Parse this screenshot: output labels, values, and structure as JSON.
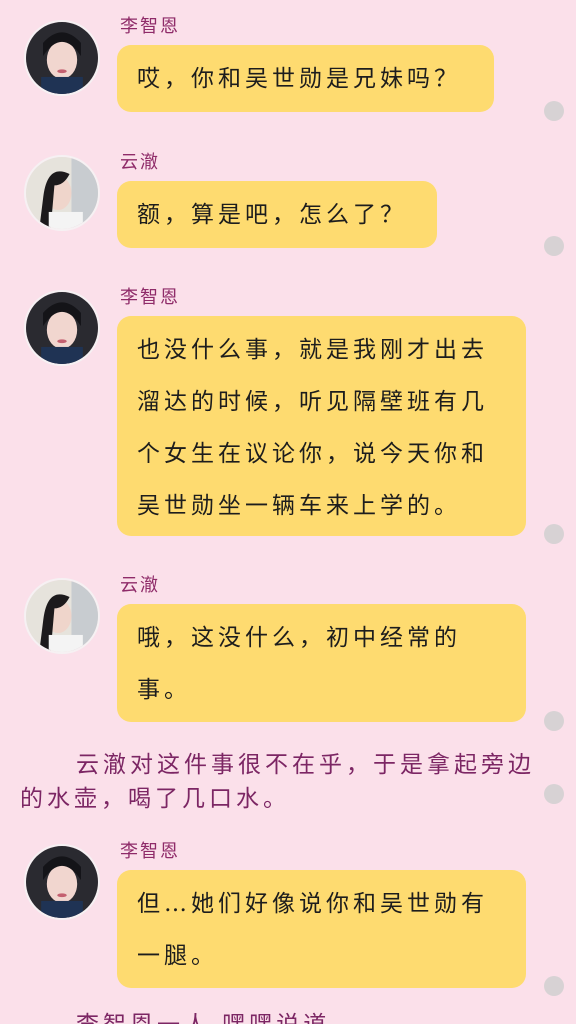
{
  "colors": {
    "background": "#fbe0ea",
    "bubble": "#fedb70",
    "name": "#8f2b69",
    "narration": "#7c2664",
    "dot": "#d7d2d4"
  },
  "messages": [
    {
      "speaker": "李智恩",
      "avatar": "avatar-li-zhien",
      "text": "哎，你和吴世勋是兄妹吗？"
    },
    {
      "speaker": "云澈",
      "avatar": "avatar-yun-che",
      "text": "额，算是吧，怎么了？"
    },
    {
      "speaker": "李智恩",
      "avatar": "avatar-li-zhien",
      "text": "也没什么事，就是我刚才出去溜达的时候，听见隔壁班有几个女生在议论你，说今天你和吴世勋坐一辆车来上学的。"
    },
    {
      "speaker": "云澈",
      "avatar": "avatar-yun-che",
      "text": "哦，这没什么，初中经常的事。"
    },
    {
      "speaker": "李智恩",
      "avatar": "avatar-li-zhien",
      "text": "但…她们好像说你和吴世勋有一腿。"
    }
  ],
  "narrations": [
    "云澈对这件事很不在乎，于是拿起旁边的水壶，喝了几口水。",
    "李智恩一人 嘿嘿说道"
  ]
}
